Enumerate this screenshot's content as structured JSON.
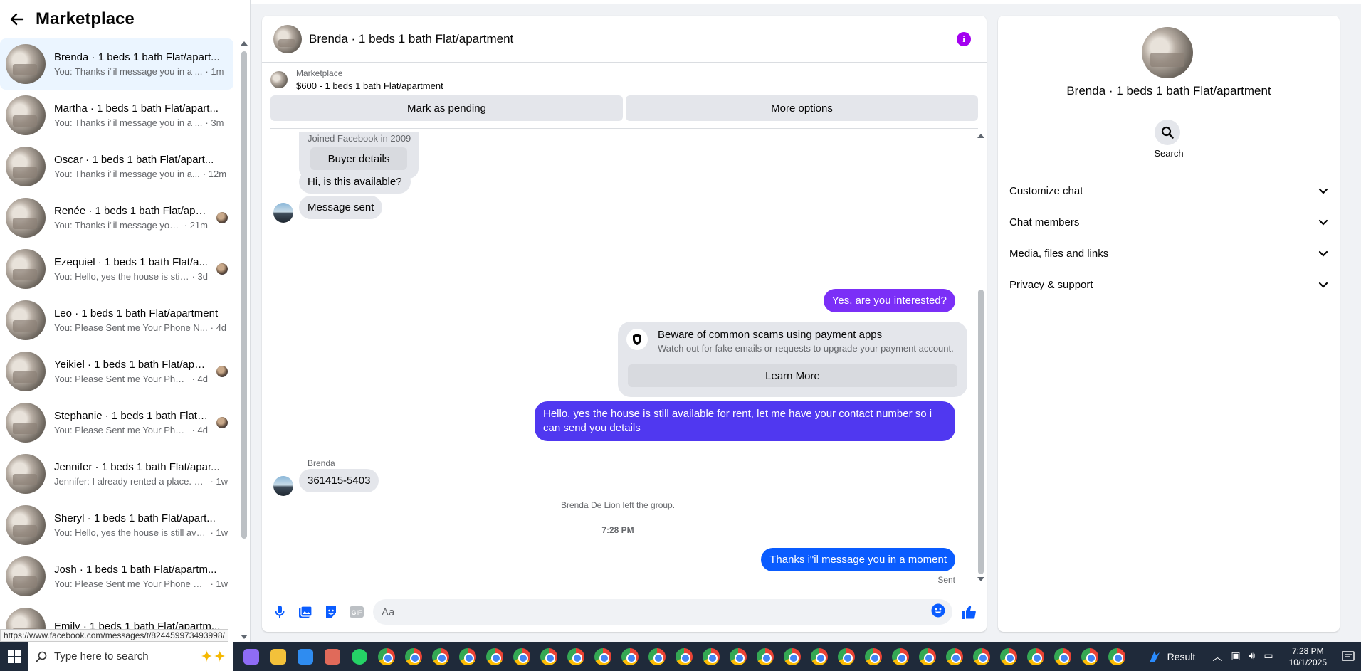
{
  "sidebar": {
    "title": "Marketplace",
    "conversations": [
      {
        "name": "Brenda · 1 beds 1 bath Flat/apart...",
        "snippet": "You: Thanks i\"il message you in a ...",
        "time": "· 1m",
        "seen": false,
        "active": true
      },
      {
        "name": "Martha · 1 beds 1 bath Flat/apart...",
        "snippet": "You: Thanks i\"il message you in a ...",
        "time": "· 3m",
        "seen": false
      },
      {
        "name": "Oscar · 1 beds 1 bath Flat/apart...",
        "snippet": "You: Thanks i\"il message you in a...",
        "time": "· 12m",
        "seen": false
      },
      {
        "name": "Renée · 1 beds 1 bath Flat/apa...",
        "snippet": "You: Thanks i\"il message you i...",
        "time": "· 21m",
        "seen": true
      },
      {
        "name": "Ezequiel · 1 beds 1 bath Flat/a...",
        "snippet": "You: Hello, yes the house is still ...",
        "time": "· 3d",
        "seen": true
      },
      {
        "name": "Leo · 1 beds 1 bath Flat/apartment",
        "snippet": "You: Please Sent me Your Phone N...",
        "time": "· 4d",
        "seen": false
      },
      {
        "name": "Yeikiel · 1 beds 1 bath Flat/apa...",
        "snippet": "You: Please Sent me Your Phone ...",
        "time": "· 4d",
        "seen": true
      },
      {
        "name": "Stephanie · 1 beds 1 bath Flat/...",
        "snippet": "You: Please Sent me Your Phone ...",
        "time": "· 4d",
        "seen": true
      },
      {
        "name": "Jennifer · 1 beds 1 bath Flat/apar...",
        "snippet": "Jennifer: I already rented a place. B...",
        "time": "· 1w",
        "seen": false
      },
      {
        "name": "Sheryl · 1 beds 1 bath Flat/apart...",
        "snippet": "You: Hello, yes the house is still ava...",
        "time": "· 1w",
        "seen": false
      },
      {
        "name": "Josh · 1 beds 1 bath Flat/apartm...",
        "snippet": "You: Please Sent me Your Phone N...",
        "time": "· 1w",
        "seen": false
      },
      {
        "name": "Emily · 1 beds 1 bath Flat/apartm...",
        "snippet": "",
        "time": "",
        "seen": false
      }
    ],
    "status_url": "https://www.facebook.com/messages/t/824459973493998/"
  },
  "chat": {
    "title": "Brenda · 1 beds 1 bath Flat/apartment",
    "listing_source": "Marketplace",
    "listing_desc": "$600 - 1 beds 1 bath Flat/apartment",
    "btn_pending": "Mark as pending",
    "btn_more": "More options",
    "joined": "Joined Facebook in 2009",
    "buyer_details": "Buyer details",
    "msg_available": "Hi, is this available?",
    "msg_sent": "Message sent",
    "msg_interested": "Yes, are you interested?",
    "scam_title": "Beware of common scams using payment apps",
    "scam_sub": "Watch out for fake emails or requests to upgrade your payment account.",
    "scam_btn": "Learn More",
    "msg_reply_line1": "Hello, yes the house is still available for rent, let me have your contact number so i",
    "msg_reply_line2": "can send you details",
    "sender_label": "Brenda",
    "msg_phone": "361415-5403",
    "left_notice": "Brenda De Lion left the group.",
    "time_divider": "7:28 PM",
    "msg_thanks": "Thanks i\"il message you in a moment",
    "sent_label": "Sent",
    "composer_placeholder": "Aa",
    "colors": {
      "purple": "#7b2ff7",
      "indigo": "#5038f0",
      "blue": "#0a5cff"
    }
  },
  "info": {
    "name": "Brenda · 1 beds 1 bath Flat/apartment",
    "search_label": "Search",
    "sections": [
      "Customize chat",
      "Chat members",
      "Media, files and links",
      "Privacy & support"
    ]
  },
  "taskbar": {
    "search_placeholder": "Type here to search",
    "result_label": "Result",
    "time": "7:28 PM",
    "date": "10/1/2025"
  }
}
